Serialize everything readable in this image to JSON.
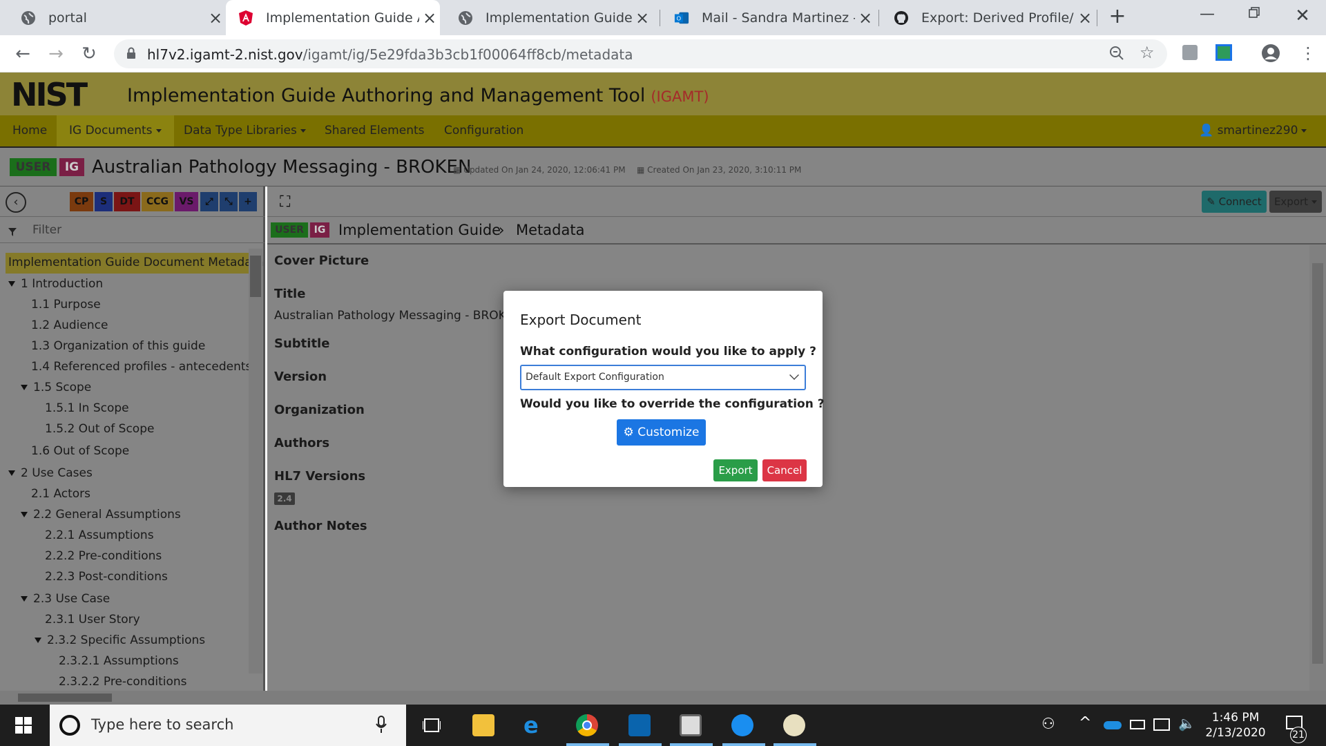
{
  "browser": {
    "tabs": [
      {
        "title": "portal",
        "icon": "globe-icon"
      },
      {
        "title": "Implementation Guide Auth",
        "icon": "angular-icon"
      },
      {
        "title": "Implementation Guide",
        "icon": "globe-icon"
      },
      {
        "title": "Mail - Sandra Martinez - Ou",
        "icon": "outlook-icon"
      },
      {
        "title": "Export: Derived Profile/Diffe",
        "icon": "github-icon"
      }
    ],
    "url_host": "hl7v2.igamt-2.nist.gov",
    "url_path": "/igamt/ig/5e29fda3b3cb1f00064ff8cb/metadata"
  },
  "app": {
    "logo": "NIST",
    "title": "Implementation Guide Authoring and Management Tool",
    "acronym": "(IGAMT)",
    "nav": [
      "Home",
      "IG Documents",
      "Data Type Libraries",
      "Shared Elements",
      "Configuration"
    ],
    "user": "smartinez290"
  },
  "ig": {
    "badge_user": "USER",
    "badge_ig": "IG",
    "title": "Australian Pathology Messaging - BROKEN",
    "updated": "Updated On Jan 24, 2020, 12:06:41 PM",
    "created": "Created On Jan 23, 2020, 3:10:11 PM"
  },
  "sidebar": {
    "buttons": [
      "CP",
      "S",
      "DT",
      "CCG",
      "VS"
    ],
    "filter_placeholder": "Filter",
    "tree": [
      "Implementation Guide Document Metadata",
      "1 Introduction",
      "1.1 Purpose",
      "1.2 Audience",
      "1.3 Organization of this guide",
      "1.4 Referenced profiles - antecedents",
      "1.5 Scope",
      "1.5.1 In Scope",
      "1.5.2 Out of Scope",
      "1.6 Out of Scope",
      "2 Use Cases",
      "2.1 Actors",
      "2.2 General Assumptions",
      "2.2.1 Assumptions",
      "2.2.2 Pre-conditions",
      "2.2.3 Post-conditions",
      "2.3 Use Case",
      "2.3.1 User Story",
      "2.3.2 Specific Assumptions",
      "2.3.2.1 Assumptions",
      "2.3.2.2 Pre-conditions"
    ]
  },
  "main": {
    "connect": "Connect",
    "export": "Export",
    "breadcrumb_root": "Implementation Guide",
    "breadcrumb_leaf": "Metadata",
    "fields": {
      "cover": "Cover Picture",
      "title": "Title",
      "title_value": "Australian Pathology Messaging - BROKEN",
      "subtitle": "Subtitle",
      "version": "Version",
      "organization": "Organization",
      "authors": "Authors",
      "hl7": "HL7 Versions",
      "hl7_value": "2.4",
      "notes": "Author Notes"
    }
  },
  "modal": {
    "title": "Export Document",
    "question1": "What configuration would you like to apply ?",
    "selected": "Default Export Configuration",
    "question2": "Would you like to override the configuration ?",
    "customize": "Customize",
    "export": "Export",
    "cancel": "Cancel"
  },
  "taskbar": {
    "search_placeholder": "Type here to search",
    "time": "1:46 PM",
    "date": "2/13/2020",
    "notifications": "21"
  }
}
